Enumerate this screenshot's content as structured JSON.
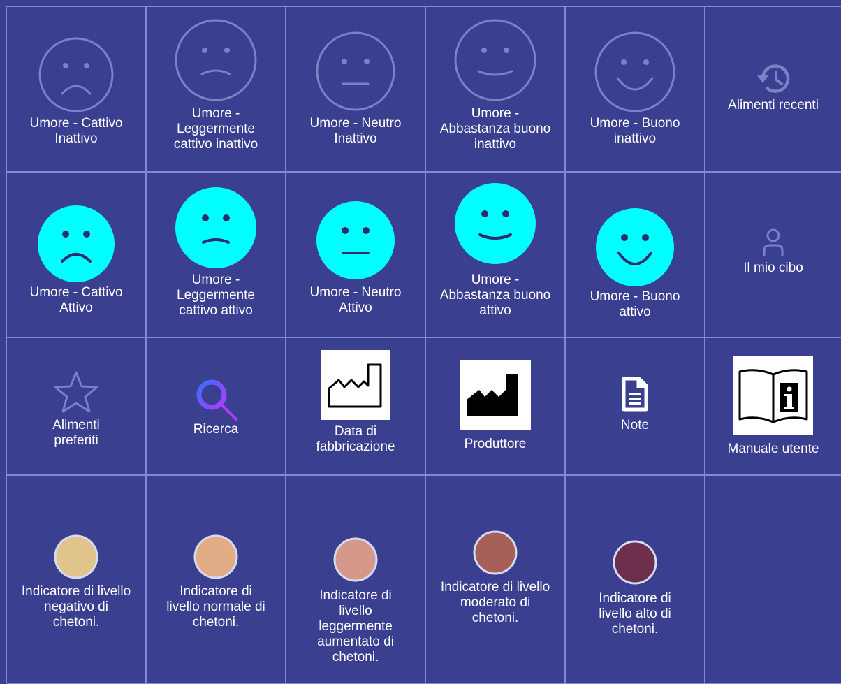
{
  "colors": {
    "background": "#3a3f8f",
    "grid_line": "#8189d6",
    "active_face": "#00ffff",
    "inactive_face": "#7b81c4",
    "ketone_negative": "#e1c48b",
    "ketone_normal": "#e2ac87",
    "ketone_slight": "#d6988a",
    "ketone_moderate": "#a76058",
    "ketone_high": "#6d2f4c"
  },
  "row1": [
    {
      "label": "Umore - Cattivo Inattivo",
      "icon": "sad-face-outline-icon"
    },
    {
      "label": "Umore - Leggermente cattivo inattivo",
      "icon": "slightly-sad-face-outline-icon"
    },
    {
      "label": "Umore - Neutro Inattivo",
      "icon": "neutral-face-outline-icon"
    },
    {
      "label": "Umore - Abbastanza buono inattivo",
      "icon": "slightly-happy-face-outline-icon"
    },
    {
      "label": "Umore - Buono inattivo",
      "icon": "happy-face-outline-icon"
    },
    {
      "label": "Alimenti recenti",
      "icon": "history-icon"
    }
  ],
  "row2": [
    {
      "label": "Umore - Cattivo Attivo",
      "icon": "sad-face-icon"
    },
    {
      "label": "Umore - Leggermente cattivo attivo",
      "icon": "slightly-sad-face-icon"
    },
    {
      "label": "Umore - Neutro Attivo",
      "icon": "neutral-face-icon"
    },
    {
      "label": "Umore - Abbastanza buono attivo",
      "icon": "slightly-happy-face-icon"
    },
    {
      "label": "Umore - Buono attivo",
      "icon": "happy-face-icon"
    },
    {
      "label": "Il mio cibo",
      "icon": "person-icon"
    }
  ],
  "row3": [
    {
      "label": "Alimenti preferiti",
      "icon": "star-icon"
    },
    {
      "label": "Ricerca",
      "icon": "search-icon"
    },
    {
      "label": "Data di fabbricazione",
      "icon": "manufacture-date-icon"
    },
    {
      "label": "Produttore",
      "icon": "manufacturer-icon"
    },
    {
      "label": "Note",
      "icon": "note-icon"
    },
    {
      "label": "Manuale utente",
      "icon": "user-manual-icon"
    }
  ],
  "row4": [
    {
      "label": "Indicatore di livello negativo di chetoni.",
      "icon": "ketone-negative-icon"
    },
    {
      "label": "Indicatore di livello normale di chetoni.",
      "icon": "ketone-normal-icon"
    },
    {
      "label": "Indicatore di livello leggermente aumentato di chetoni.",
      "icon": "ketone-slight-icon"
    },
    {
      "label": "Indicatore di livello moderato di chetoni.",
      "icon": "ketone-moderate-icon"
    },
    {
      "label": "Indicatore di livello alto di chetoni.",
      "icon": "ketone-high-icon"
    }
  ]
}
